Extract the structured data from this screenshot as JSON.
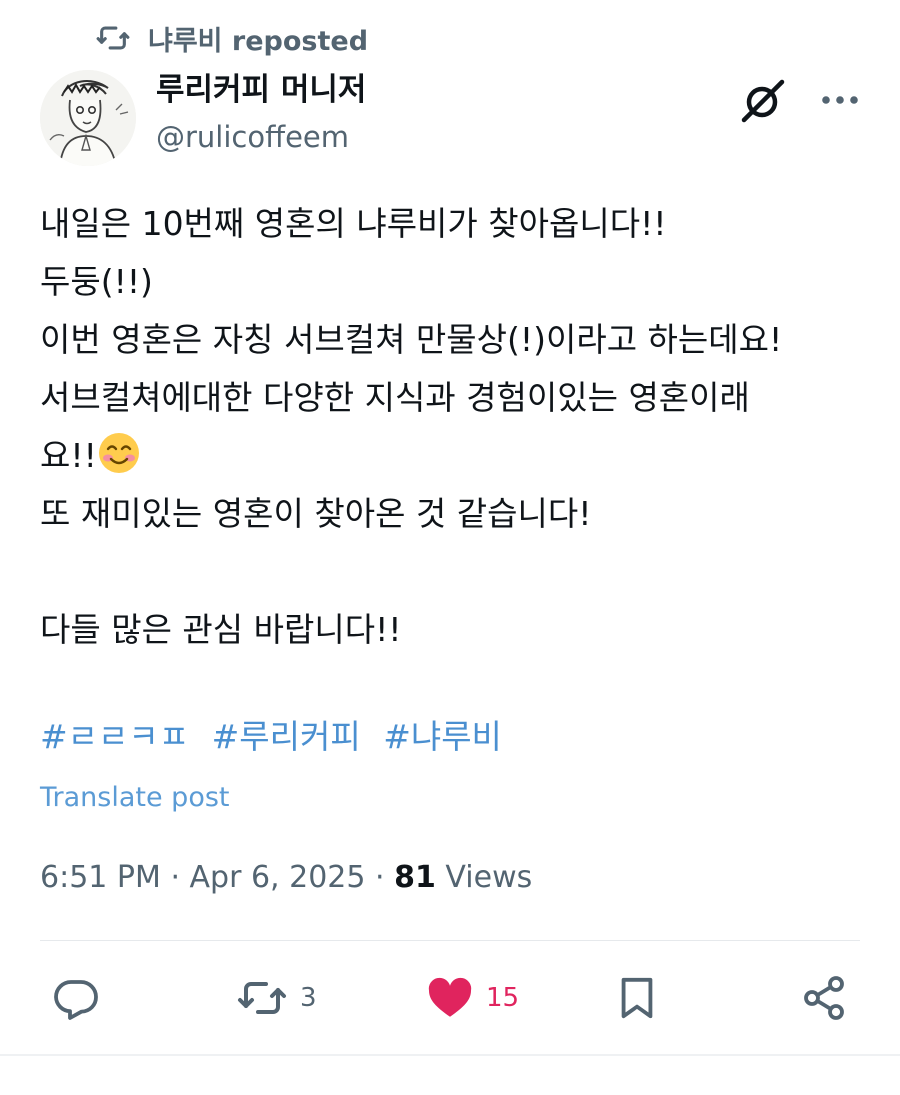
{
  "repost": {
    "label": "냐루비 reposted",
    "icon": "repost-icon"
  },
  "author": {
    "name": "루리커피 머니저",
    "handle": "@rulicoffeem",
    "avatar_icon": "avatar-sketch"
  },
  "header_icons": [
    "grok-icon",
    "more-icon"
  ],
  "post": {
    "lines": [
      "내일은 10번째 영혼의 냐루비가 찾아옵니다!!",
      "두둥(!!)",
      "이번 영혼은 자칭 서브컬쳐 만물상(!)이라고 하는데요!",
      "서브컬쳐에대한 다양한 지식과 경험이있는 영혼이래",
      "요!!",
      "또 재미있는 영혼이 찾아온 것 같습니다!",
      "",
      "다들 많은 관심 바랍니다!!"
    ],
    "emoji": "smiling-face-emoji",
    "hashtags": [
      "#ㄹㄹㅋㅍ",
      "#루리커피",
      "#냐루비"
    ],
    "translate_label": "Translate post"
  },
  "meta": {
    "time": "6:51 PM",
    "separator": "·",
    "date": "Apr 6, 2025",
    "views_count": "81",
    "views_label": "Views"
  },
  "actions": {
    "reply": {
      "icon": "reply-icon",
      "count": ""
    },
    "repost": {
      "icon": "repost-icon",
      "count": "3"
    },
    "like": {
      "icon": "heart-icon",
      "count": "15"
    },
    "bookmark": {
      "icon": "bookmark-icon",
      "count": ""
    },
    "share": {
      "icon": "share-icon",
      "count": ""
    }
  },
  "colors": {
    "text": "#0f1419",
    "secondary": "#536471",
    "link": "#4a8fd0",
    "like": "#e0245e"
  }
}
